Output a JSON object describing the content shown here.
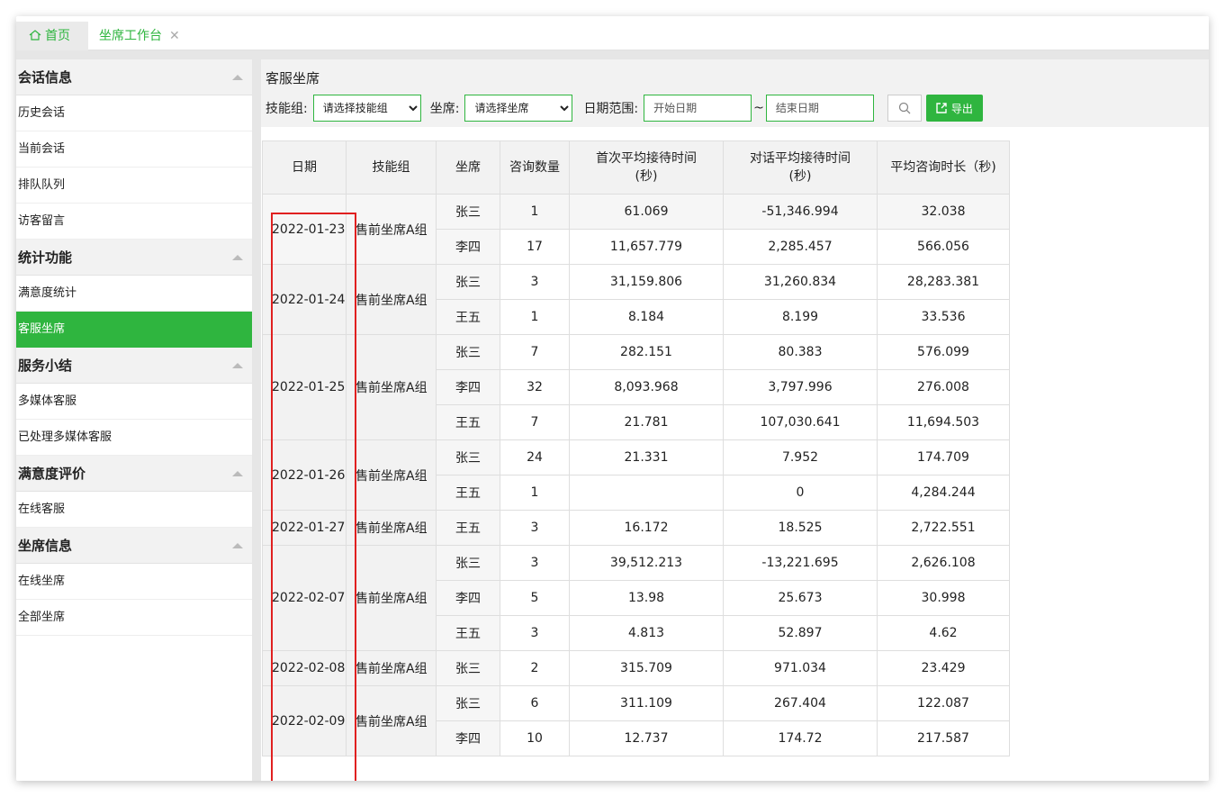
{
  "tabs": {
    "home_label": "首页",
    "workbench_label": "坐席工作台",
    "close_glyph": "✕"
  },
  "sidebar": {
    "groups": [
      {
        "title": "会话信息",
        "items": [
          {
            "label": "历史会话"
          },
          {
            "label": "当前会话"
          },
          {
            "label": "排队队列"
          },
          {
            "label": "访客留言"
          }
        ]
      },
      {
        "title": "统计功能",
        "items": [
          {
            "label": "满意度统计"
          },
          {
            "label": "客服坐席",
            "active": true
          }
        ]
      },
      {
        "title": "服务小结",
        "items": [
          {
            "label": "多媒体客服"
          },
          {
            "label": "已处理多媒体客服"
          }
        ]
      },
      {
        "title": "满意度评价",
        "items": [
          {
            "label": "在线客服"
          }
        ]
      },
      {
        "title": "坐席信息",
        "items": [
          {
            "label": "在线坐席"
          },
          {
            "label": "全部坐席"
          }
        ]
      }
    ]
  },
  "main": {
    "title": "客服坐席",
    "filters": {
      "skill_group_label": "技能组:",
      "skill_group_value": "请选择技能组",
      "agent_label": "坐席:",
      "agent_value": "请选择坐席",
      "date_range_label": "日期范围:",
      "start_placeholder": "开始日期",
      "tilde": "~",
      "end_placeholder": "结束日期",
      "export_label": "导出"
    },
    "table": {
      "headers": [
        "日期",
        "技能组",
        "坐席",
        "咨询数量",
        "首次平均接待时间\n(秒)",
        "对话平均接待时间\n(秒)",
        "平均咨询时长（秒)"
      ],
      "groups": [
        {
          "date": "2022-01-23",
          "skill": "售前坐席A组",
          "rows": [
            {
              "agent": "张三",
              "count": "1",
              "first": "61.069",
              "dialog": "-51,346.994",
              "avg": "32.038"
            },
            {
              "agent": "李四",
              "count": "17",
              "first": "11,657.779",
              "dialog": "2,285.457",
              "avg": "566.056"
            }
          ]
        },
        {
          "date": "2022-01-24",
          "skill": "售前坐席A组",
          "rows": [
            {
              "agent": "张三",
              "count": "3",
              "first": "31,159.806",
              "dialog": "31,260.834",
              "avg": "28,283.381"
            },
            {
              "agent": "王五",
              "count": "1",
              "first": "8.184",
              "dialog": "8.199",
              "avg": "33.536"
            }
          ]
        },
        {
          "date": "2022-01-25",
          "skill": "售前坐席A组",
          "rows": [
            {
              "agent": "张三",
              "count": "7",
              "first": "282.151",
              "dialog": "80.383",
              "avg": "576.099"
            },
            {
              "agent": "李四",
              "count": "32",
              "first": "8,093.968",
              "dialog": "3,797.996",
              "avg": "276.008"
            },
            {
              "agent": "王五",
              "count": "7",
              "first": "21.781",
              "dialog": "107,030.641",
              "avg": "11,694.503"
            }
          ]
        },
        {
          "date": "2022-01-26",
          "skill": "售前坐席A组",
          "rows": [
            {
              "agent": "张三",
              "count": "24",
              "first": "21.331",
              "dialog": "7.952",
              "avg": "174.709"
            },
            {
              "agent": "王五",
              "count": "1",
              "first": "",
              "dialog": "0",
              "avg": "4,284.244"
            }
          ]
        },
        {
          "date": "2022-01-27",
          "skill": "售前坐席A组",
          "rows": [
            {
              "agent": "王五",
              "count": "3",
              "first": "16.172",
              "dialog": "18.525",
              "avg": "2,722.551"
            }
          ]
        },
        {
          "date": "2022-02-07",
          "skill": "售前坐席A组",
          "rows": [
            {
              "agent": "张三",
              "count": "3",
              "first": "39,512.213",
              "dialog": "-13,221.695",
              "avg": "2,626.108"
            },
            {
              "agent": "李四",
              "count": "5",
              "first": "13.98",
              "dialog": "25.673",
              "avg": "30.998"
            },
            {
              "agent": "王五",
              "count": "3",
              "first": "4.813",
              "dialog": "52.897",
              "avg": "4.62"
            }
          ]
        },
        {
          "date": "2022-02-08",
          "skill": "售前坐席A组",
          "rows": [
            {
              "agent": "张三",
              "count": "2",
              "first": "315.709",
              "dialog": "971.034",
              "avg": "23.429"
            }
          ]
        },
        {
          "date": "2022-02-09",
          "skill": "售前坐席A组",
          "rows": [
            {
              "agent": "张三",
              "count": "6",
              "first": "311.109",
              "dialog": "267.404",
              "avg": "122.087"
            },
            {
              "agent": "李四",
              "count": "10",
              "first": "12.737",
              "dialog": "174.72",
              "avg": "217.587"
            }
          ]
        }
      ]
    }
  },
  "colors": {
    "accent": "#2fb53f",
    "highlight_box": "#e02020"
  }
}
